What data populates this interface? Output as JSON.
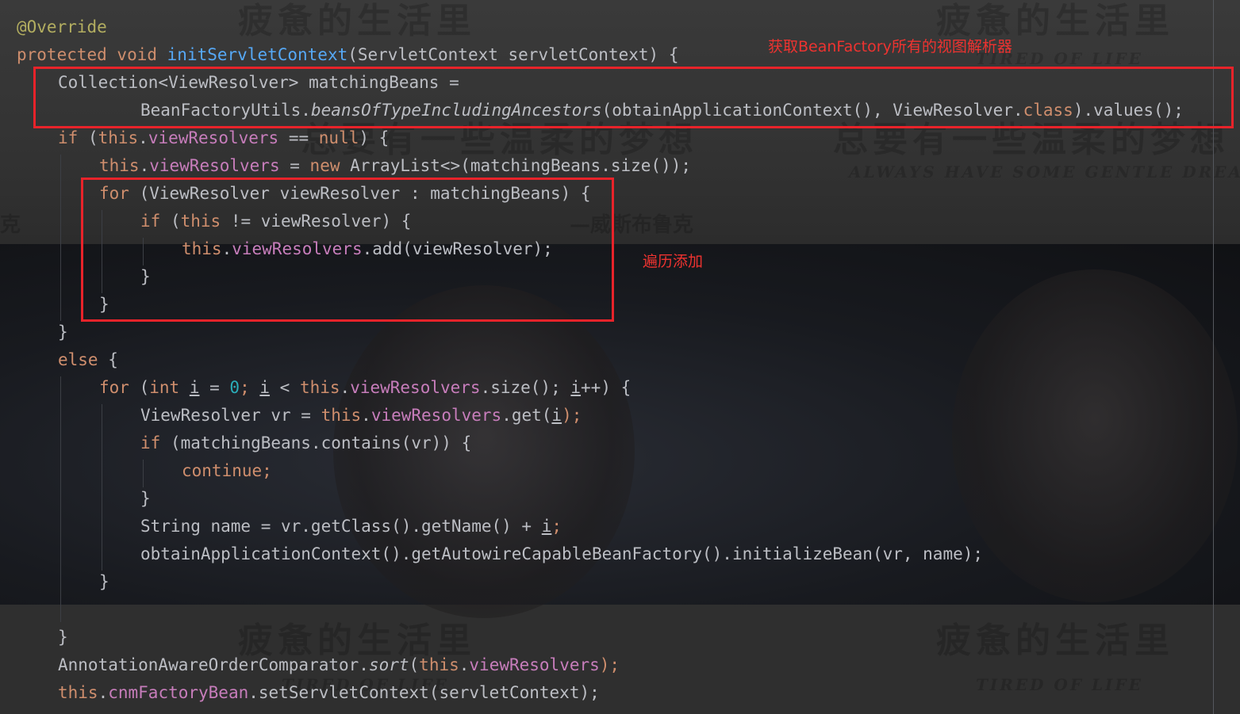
{
  "annotations": {
    "box1_note": "获取BeanFactory所有的视图解析器",
    "box2_note": "遍历添加"
  },
  "watermarks": {
    "title": "疲惫的生活里",
    "subtitle_en": "TIRED OF LIFE",
    "line2": "总要有一些温柔的梦想",
    "line2_en": "ALWAYS HAVE SOME GENTLE DREAMS",
    "author": "—威斯布鲁克",
    "edge_char": "克"
  },
  "code": {
    "l1": "@Override",
    "l2_kw": "protected void ",
    "l2_fn": "initServletContext",
    "l2_rest": "(ServletContext servletContext) {",
    "l3": "Collection<ViewResolver> matchingBeans =",
    "l4_a": "BeanFactoryUtils.",
    "l4_b": "beansOfTypeIncludingAncestors",
    "l4_c": "(obtainApplicationContext(), ViewResolver.",
    "l4_d": "class",
    "l4_e": ").values();",
    "l5_a": "if",
    "l5_b": " (",
    "l5_c": "this",
    "l5_d": ".",
    "l5_e": "viewResolvers",
    "l5_f": " == ",
    "l5_g": "null",
    "l5_h": ") {",
    "l6_a": "this",
    "l6_b": ".",
    "l6_c": "viewResolvers",
    "l6_d": " = ",
    "l6_e": "new",
    "l6_f": " ArrayList<>(matchingBeans.size());",
    "l7_a": "for",
    "l7_b": " (ViewResolver viewResolver : matchingBeans) {",
    "l8_a": "if",
    "l8_b": " (",
    "l8_c": "this",
    "l8_d": " != viewResolver) {",
    "l9_a": "this",
    "l9_b": ".",
    "l9_c": "viewResolvers",
    "l9_d": ".add(viewResolver);",
    "l10": "}",
    "l11": "}",
    "l12": "}",
    "l13_a": "else",
    "l13_b": " {",
    "l14_a": "for",
    "l14_b": " (",
    "l14_c": "int",
    "l14_d": " ",
    "l14_e": "i",
    "l14_f": " = ",
    "l14_g": "0",
    "l14_h": "; ",
    "l14_i": "i",
    "l14_j": " < ",
    "l14_k": "this",
    "l14_l": ".",
    "l14_m": "viewResolvers",
    "l14_n": ".size(); ",
    "l14_o": "i",
    "l14_p": "++) {",
    "l15_a": "ViewResolver vr = ",
    "l15_b": "this",
    "l15_c": ".",
    "l15_d": "viewResolvers",
    "l15_e": ".get(",
    "l15_f": "i",
    "l15_g": ");",
    "l16_a": "if",
    "l16_b": " (matchingBeans.contains(vr)) {",
    "l17": "continue;",
    "l18": "}",
    "l19_a": "String name = vr.getClass().getName() + ",
    "l19_b": "i",
    "l19_c": ";",
    "l20": "obtainApplicationContext().getAutowireCapableBeanFactory().initializeBean(vr, name);",
    "l21": "}",
    "l22": "}",
    "l23_a": "AnnotationAwareOrderComparator.",
    "l23_b": "sort",
    "l23_c": "(",
    "l23_d": "this",
    "l23_e": ".",
    "l23_f": "viewResolvers",
    "l23_g": ");",
    "l24_a": "this",
    "l24_b": ".",
    "l24_c": "cnmFactoryBean",
    "l24_d": ".setServletContext(servletContext);"
  },
  "colors": {
    "keyword": "#cf8e6d",
    "method": "#56a8f5",
    "field": "#c77dbb",
    "annotation": "#b3ae60",
    "number": "#2aacb8",
    "text": "#bcbec4",
    "highlight_box": "#e8232a",
    "note_text": "#ee3330"
  }
}
